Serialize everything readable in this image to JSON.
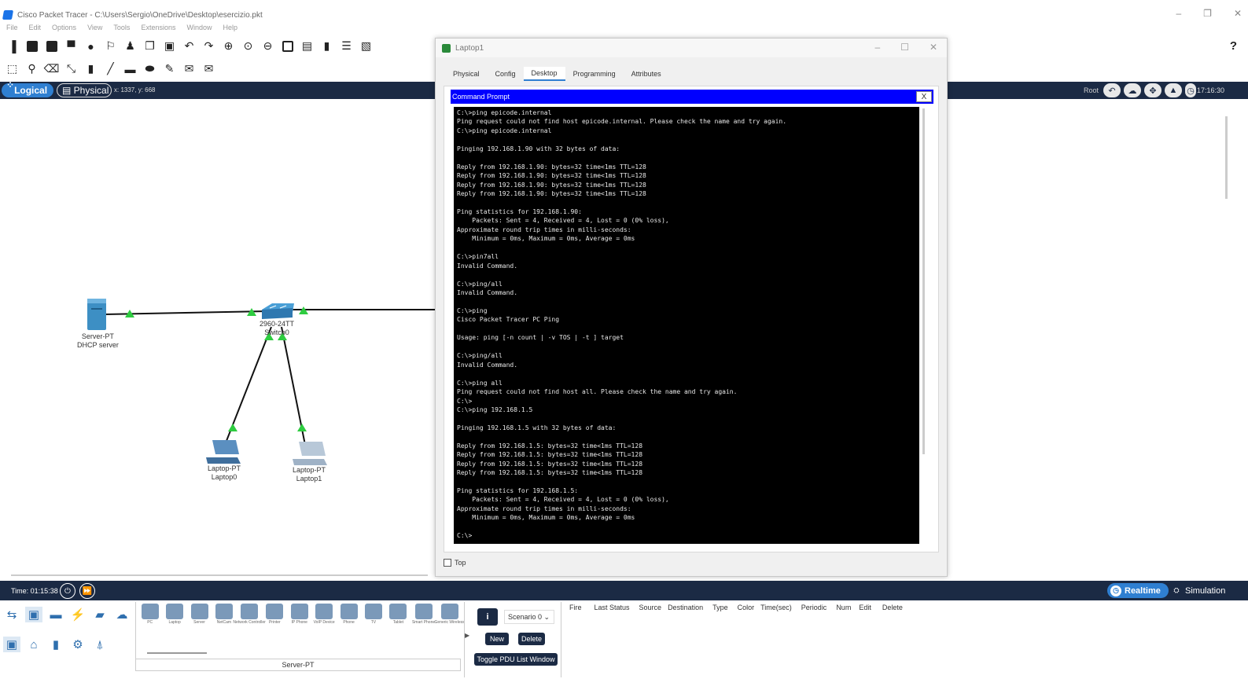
{
  "window": {
    "title": "Cisco Packet Tracer - C:\\Users\\Sergio\\OneDrive\\Desktop\\esercizio.pkt",
    "controls": [
      "–",
      "❐",
      "✕"
    ]
  },
  "menu": [
    "File",
    "Edit",
    "Options",
    "View",
    "Tools",
    "Extensions",
    "Window",
    "Help"
  ],
  "help_label": "?",
  "logical_bar": {
    "logical": "Logical",
    "physical": "Physical",
    "coords": "x: 1337, y: 668",
    "root": "Root",
    "clock": "17:16:30"
  },
  "topology": {
    "server": {
      "line1": "Server-PT",
      "line2": "DHCP server"
    },
    "switch": {
      "line1": "2960-24TT",
      "line2": "Switch0"
    },
    "laptop0": {
      "line1": "Laptop-PT",
      "line2": "Laptop0"
    },
    "laptop1": {
      "line1": "Laptop-PT",
      "line2": "Laptop1"
    }
  },
  "laptop_window": {
    "title": "Laptop1",
    "controls": [
      "–",
      "☐",
      "✕"
    ],
    "tabs": [
      {
        "label": "Physical",
        "active": false
      },
      {
        "label": "Config",
        "active": false
      },
      {
        "label": "Desktop",
        "active": true
      },
      {
        "label": "Programming",
        "active": false
      },
      {
        "label": "Attributes",
        "active": false
      }
    ],
    "cmd_title": "Command Prompt",
    "cmd_close": "X",
    "terminal_lines": [
      "C:\\>ping epicode.internal",
      "Ping request could not find host epicode.internal. Please check the name and try again.",
      "C:\\>ping epicode.internal",
      "",
      "Pinging 192.168.1.90 with 32 bytes of data:",
      "",
      "Reply from 192.168.1.90: bytes=32 time<1ms TTL=128",
      "Reply from 192.168.1.90: bytes=32 time<1ms TTL=128",
      "Reply from 192.168.1.90: bytes=32 time<1ms TTL=128",
      "Reply from 192.168.1.90: bytes=32 time<1ms TTL=128",
      "",
      "Ping statistics for 192.168.1.90:",
      "    Packets: Sent = 4, Received = 4, Lost = 0 (0% loss),",
      "Approximate round trip times in milli-seconds:",
      "    Minimum = 0ms, Maximum = 0ms, Average = 0ms",
      "",
      "C:\\>pin7all",
      "Invalid Command.",
      "",
      "C:\\>ping/all",
      "Invalid Command.",
      "",
      "C:\\>ping",
      "Cisco Packet Tracer PC Ping",
      "",
      "Usage: ping [-n count | -v TOS | -t ] target",
      "",
      "C:\\>ping/all",
      "Invalid Command.",
      "",
      "C:\\>ping all",
      "Ping request could not find host all. Please check the name and try again.",
      "C:\\>",
      "C:\\>ping 192.168.1.5",
      "",
      "Pinging 192.168.1.5 with 32 bytes of data:",
      "",
      "Reply from 192.168.1.5: bytes=32 time<1ms TTL=128",
      "Reply from 192.168.1.5: bytes=32 time<1ms TTL=128",
      "Reply from 192.168.1.5: bytes=32 time<1ms TTL=128",
      "Reply from 192.168.1.5: bytes=32 time<1ms TTL=128",
      "",
      "Ping statistics for 192.168.1.5:",
      "    Packets: Sent = 4, Received = 4, Lost = 0 (0% loss),",
      "Approximate round trip times in milli-seconds:",
      "    Minimum = 0ms, Maximum = 0ms, Average = 0ms",
      "",
      "C:\\>"
    ],
    "top_checkbox": "Top"
  },
  "timebar": {
    "time": "Time: 01:15:38",
    "realtime": "Realtime",
    "simulation": "Simulation"
  },
  "bottom": {
    "devices": [
      {
        "label": "PC"
      },
      {
        "label": "Laptop"
      },
      {
        "label": "Server"
      },
      {
        "label": "NetCam"
      },
      {
        "label": "Network Controller"
      },
      {
        "label": "Printer"
      },
      {
        "label": "IP Phone"
      },
      {
        "label": "VoIP Device"
      },
      {
        "label": "Phone"
      },
      {
        "label": "TV"
      },
      {
        "label": "Tablet"
      },
      {
        "label": "Smart Phone"
      },
      {
        "label": "Generic Wireless"
      }
    ],
    "selected_device": "Server-PT",
    "scenario": {
      "info": "i",
      "select": "Scenario 0",
      "new": "New",
      "delete": "Delete",
      "toggle": "Toggle PDU List Window"
    },
    "pdu_columns": [
      "Fire",
      "Last Status",
      "Source",
      "Destination",
      "Type",
      "Color",
      "Time(sec)",
      "Periodic",
      "Num",
      "Edit",
      "Delete"
    ]
  },
  "colors": {
    "dark_bar": "#1b2a44",
    "accent": "#2f7fd1",
    "cmd_header": "#0000ff",
    "link_up": "#2ecc40"
  }
}
